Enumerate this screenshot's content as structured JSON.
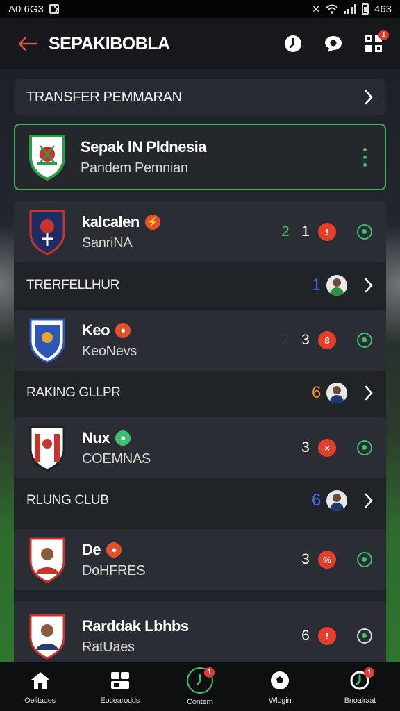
{
  "status_bar": {
    "left_text": "A0 6G3",
    "right_text": "463"
  },
  "app_bar": {
    "title": "SEPAKIBOBLA",
    "icons": [
      "back-arrow-icon",
      "clock-icon",
      "chat-icon",
      "grid-menu-icon"
    ],
    "grid_badge": "1"
  },
  "transfer_bar": {
    "label": "TRANSFER PEMMARAN"
  },
  "featured": {
    "name": "Sepak lN Pldnesia",
    "subtitle": "Pandem Pemnian"
  },
  "clubs": [
    {
      "name": "kalcalen",
      "sub": "SanriNA",
      "stat_a": "2",
      "stat_b": "1",
      "badge": "!"
    },
    {
      "name": "Keo",
      "sub": "KeoNevs",
      "stat_a": "2",
      "stat_b": "3",
      "badge": "8"
    },
    {
      "name": "Nux",
      "sub": "COEMNAS",
      "stat_a": "",
      "stat_b": "3",
      "badge": "×"
    },
    {
      "name": "De",
      "sub": "DoHFRES",
      "stat_a": "",
      "stat_b": "3",
      "badge": "%"
    },
    {
      "name": "Rarddak Lbhbs",
      "sub": "RatUaes",
      "stat_a": "",
      "stat_b": "6",
      "badge": "!"
    }
  ],
  "sub_rows": [
    {
      "label": "TRERFELLHUR",
      "num": "1",
      "num_color": "#4a6cf0"
    },
    {
      "label": "RAKING GLLPR",
      "num": "6",
      "num_color": "#f0921e"
    },
    {
      "label": "RLUNG CLUB",
      "num": "6",
      "num_color": "#4a6cf0"
    }
  ],
  "bottom_nav": [
    {
      "label": "Oelitades",
      "icon": "home-icon"
    },
    {
      "label": "Eocearodds",
      "icon": "dashboard-icon"
    },
    {
      "label": "Contern",
      "icon": "clock-icon",
      "badge": "1"
    },
    {
      "label": "Wlogin",
      "icon": "soccer-ball-icon"
    },
    {
      "label": "Bnoairaat",
      "icon": "stats-icon",
      "badge": "1"
    }
  ],
  "colors": {
    "accent": "#3cc06b",
    "danger": "#e33f2c",
    "back_arrow": "#e3503f"
  }
}
